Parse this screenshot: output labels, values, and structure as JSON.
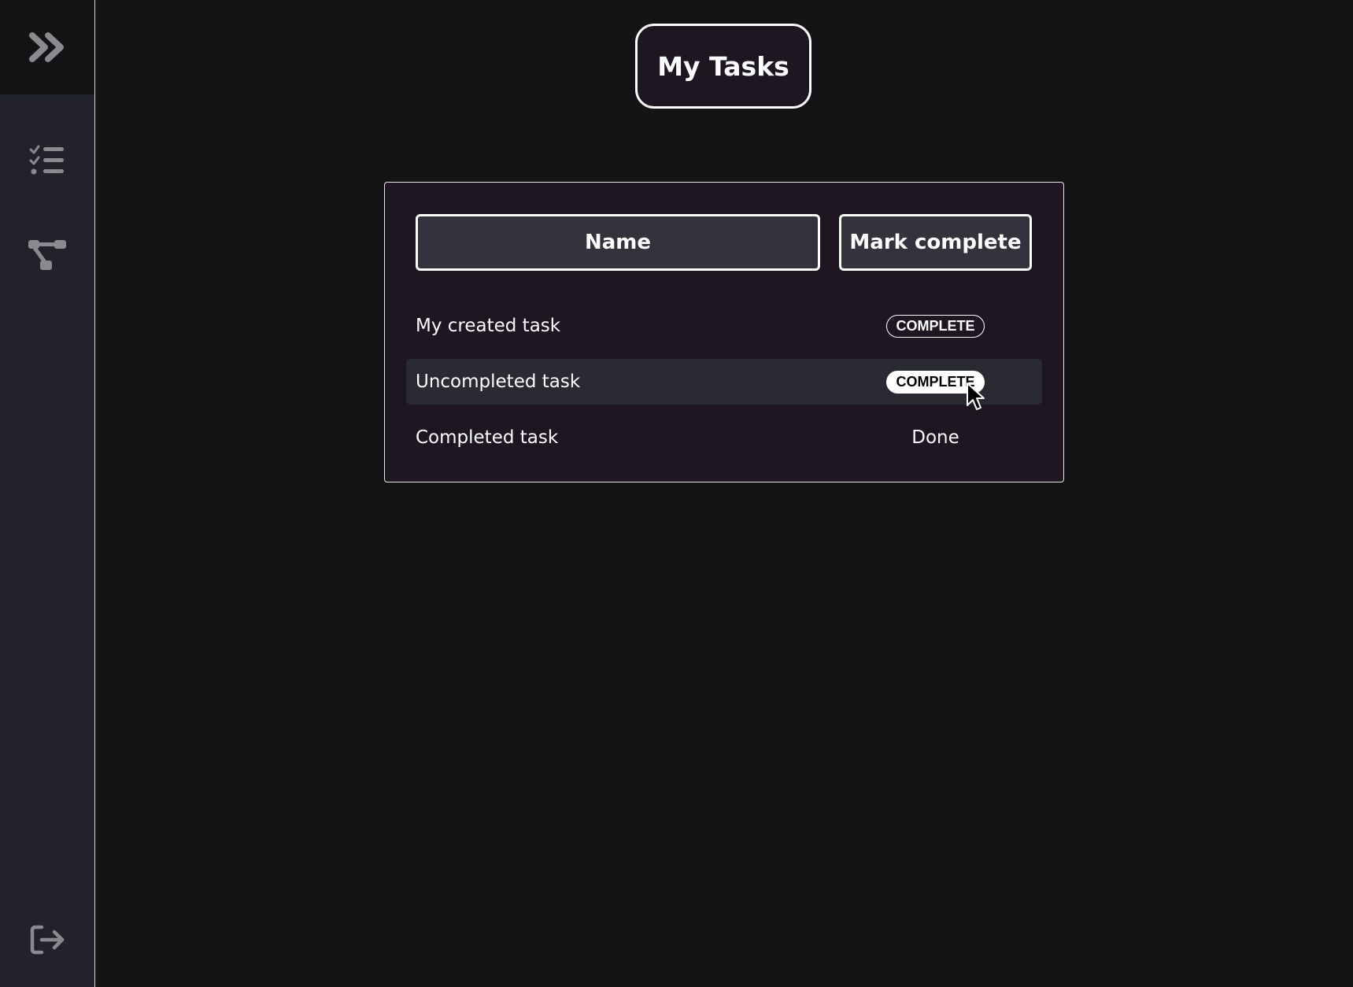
{
  "sidebar": {
    "toggle_icon": "double-chevron-right-icon",
    "items": [
      {
        "icon": "checklist-icon",
        "name": "tasks"
      },
      {
        "icon": "workflow-icon",
        "name": "workflow"
      }
    ],
    "logout_icon": "logout-icon",
    "colors": {
      "background": "#22222b",
      "icon": "#8a8a8e",
      "top": "#141416"
    }
  },
  "header": {
    "title": "My Tasks"
  },
  "table": {
    "columns": [
      "Name",
      "Mark complete"
    ],
    "rows": [
      {
        "name": "My created task",
        "action": "COMPLETE",
        "state": "button"
      },
      {
        "name": "Uncompleted task",
        "action": "COMPLETE",
        "state": "button-hover"
      },
      {
        "name": "Completed task",
        "action": "Done",
        "state": "done"
      }
    ]
  },
  "colors": {
    "page_background": "#141416",
    "card_background": "#1e1721",
    "header_cell": "#33333d",
    "row_hover": "#2a2a33",
    "text": "#ffffff"
  }
}
